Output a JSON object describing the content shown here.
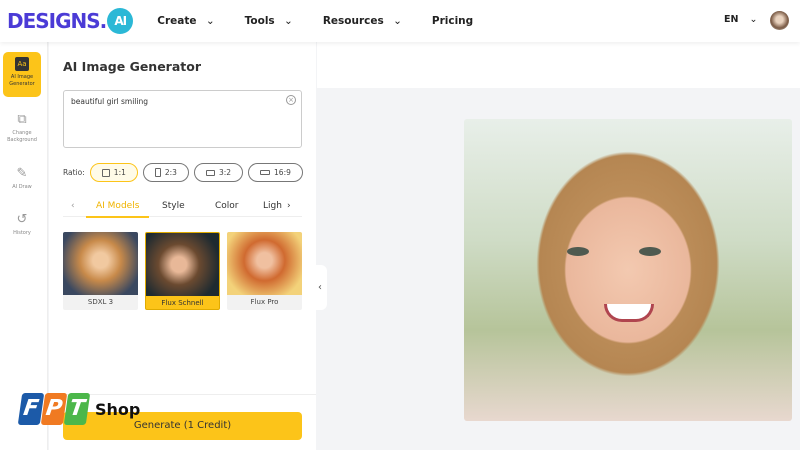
{
  "header": {
    "logo": "DESIGNS.",
    "logo_badge": "AI",
    "nav": [
      "Create",
      "Tools",
      "Resources",
      "Pricing"
    ],
    "language": "EN"
  },
  "sidebar": {
    "items": [
      {
        "icon": "Aa",
        "label": "AI Image Generator"
      },
      {
        "label": "Change Background"
      },
      {
        "label": "AI Draw"
      },
      {
        "label": "History"
      }
    ]
  },
  "panel": {
    "title": "AI Image Generator",
    "prompt": "beautiful girl smiling",
    "ratio_label": "Ratio:",
    "ratios": [
      "1:1",
      "2:3",
      "3:2",
      "16:9"
    ],
    "tabs": [
      "AI Models",
      "Style",
      "Color",
      "Ligh"
    ],
    "models": [
      "SDXL 3",
      "Flux Schnell",
      "Flux Pro"
    ],
    "generate": "Generate (1 Credit)"
  },
  "watermark": {
    "letters": [
      "F",
      "P",
      "T"
    ],
    "text": "Shop",
    "colors": [
      "#1c5aa8",
      "#f07a22",
      "#4cb74a"
    ]
  }
}
